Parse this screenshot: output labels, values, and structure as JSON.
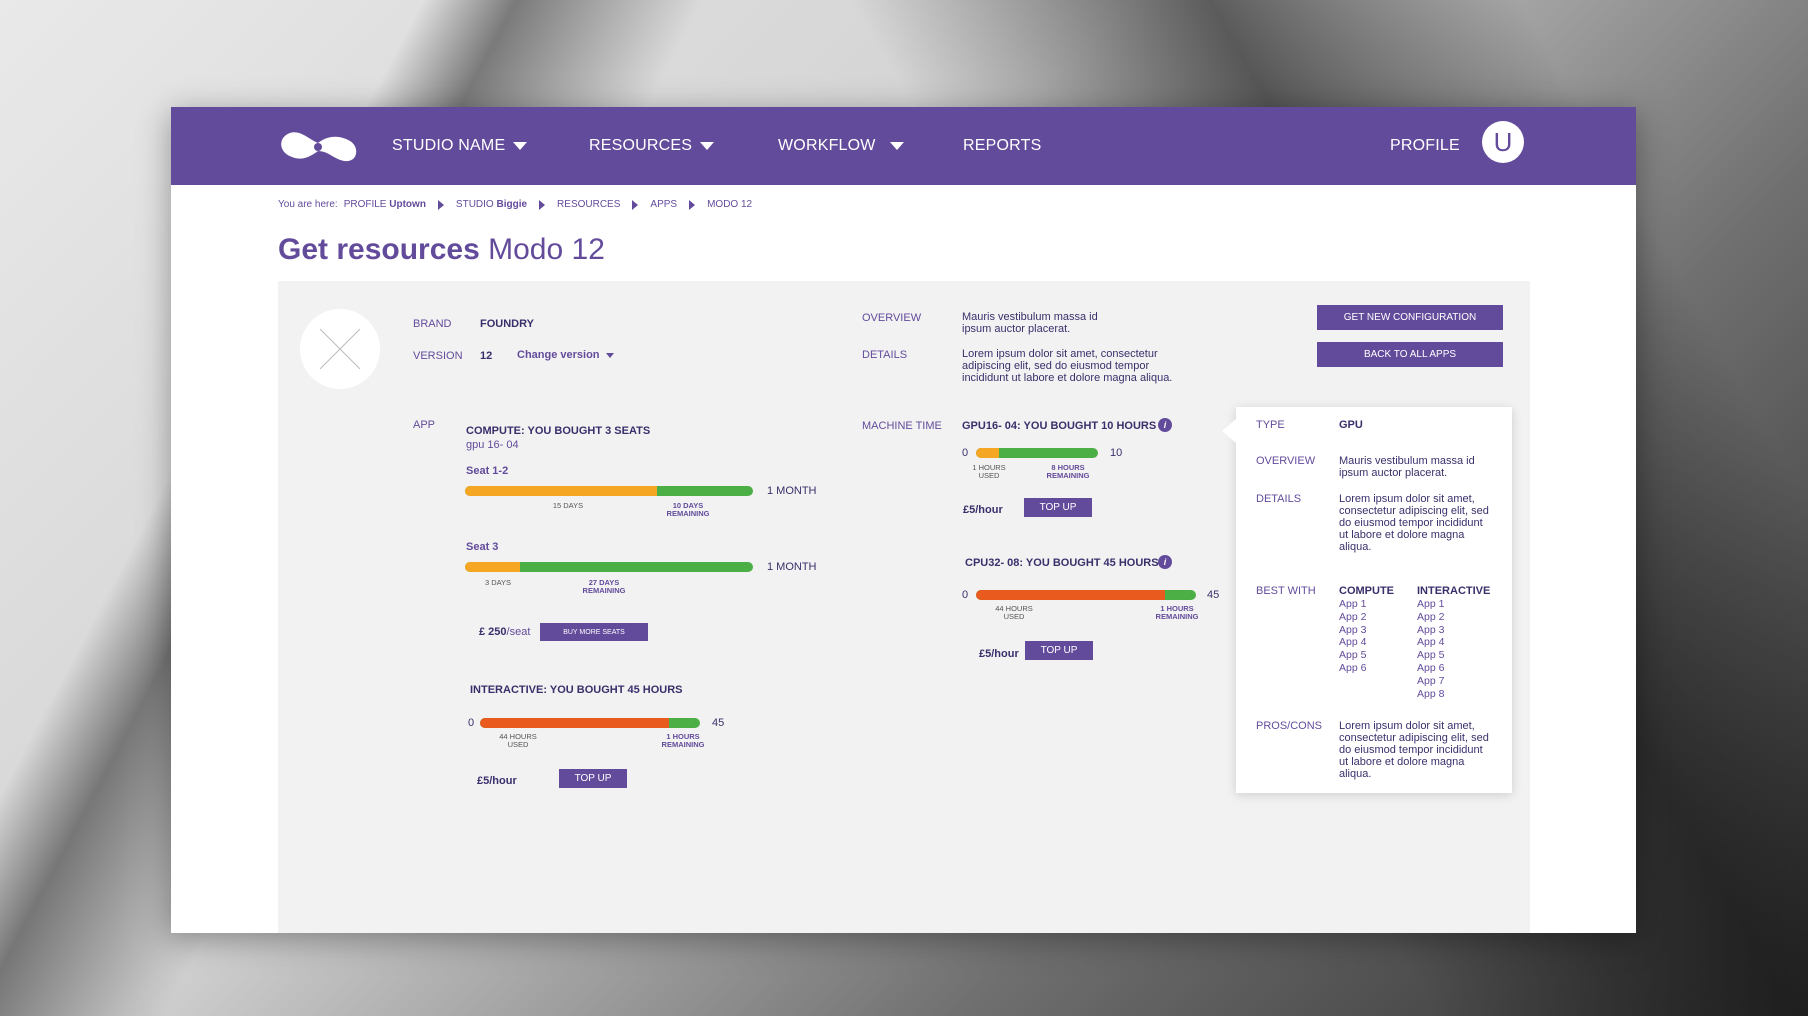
{
  "nav": {
    "studio": "STUDIO NAME",
    "resources": "RESOURCES",
    "workflow": "WORKFLOW",
    "reports": "REPORTS",
    "profile": "PROFILE",
    "avatar_initial": "U"
  },
  "breadcrumb": {
    "prefix": "You are here:",
    "profile_label": "PROFILE",
    "profile_value": "Uptown",
    "studio_label": "STUDIO",
    "studio_value": "Biggie",
    "resources": "RESOURCES",
    "apps": "APPS",
    "current": "MODO 12"
  },
  "title": {
    "bold": "Get resources",
    "rest": "Modo 12"
  },
  "product": {
    "brand_label": "BRAND",
    "brand_value": "FOUNDRY",
    "version_label": "VERSION",
    "version_value": "12",
    "change_version": "Change version",
    "overview_label": "OVERVIEW",
    "overview_text_1": "Mauris vestibulum massa id",
    "overview_text_2": "ipsum auctor placerat.",
    "details_label": "DETAILS",
    "details_text_1": "Lorem ipsum dolor sit amet, consectetur",
    "details_text_2": "adipiscing elit, sed do eiusmod tempor",
    "details_text_3": "incididunt ut labore et dolore magna aliqua.",
    "get_config": "GET NEW CONFIGURATION",
    "back_all": "BACK TO ALL APPS"
  },
  "app": {
    "label": "APP",
    "compute_title": "COMPUTE: YOU BOUGHT 3 SEATS",
    "compute_sub": "gpu 16- 04",
    "seat1": {
      "label": "Seat 1-2",
      "used_fraction": 0.665,
      "used": "15 DAYS",
      "remaining_1": "10 DAYS",
      "remaining_2": "REMAINING",
      "end": "1 MONTH"
    },
    "seat2": {
      "label": "Seat 3",
      "used_fraction": 0.19,
      "used": "3 DAYS",
      "remaining_1": "27 DAYS",
      "remaining_2": "REMAINING",
      "end": "1 MONTH"
    },
    "seat_price": "£ 250",
    "seat_unit": "/seat",
    "buy_more": "BUY MORE SEATS",
    "interactive_title": "INTERACTIVE: YOU BOUGHT 45 HOURS",
    "interactive": {
      "start": "0",
      "end": "45",
      "used_fraction": 0.86,
      "used_1": "44 HOURS",
      "used_2": "USED",
      "remaining_1": "1 HOURS",
      "remaining_2": "REMAINING"
    },
    "interactive_price": "£5/hour",
    "top_up": "TOP UP"
  },
  "machine": {
    "label": "MACHINE TIME",
    "gpu_title": "GPU16- 04: YOU BOUGHT 10 HOURS",
    "gpu": {
      "start": "0",
      "end": "10",
      "used_fraction": 0.19,
      "used_1": "1 HOURS",
      "used_2": "USED",
      "remaining_1": "8 HOURS",
      "remaining_2": "REMAINING"
    },
    "gpu_price": "£5/hour",
    "cpu_title": "CPU32- 08: YOU BOUGHT 45 HOURS",
    "cpu": {
      "start": "0",
      "end": "45",
      "used_fraction": 0.86,
      "used_1": "44 HOURS",
      "used_2": "USED",
      "remaining_1": "1 HOURS",
      "remaining_2": "REMAINING"
    },
    "cpu_price": "£5/hour",
    "top_up": "TOP UP",
    "info_glyph": "i"
  },
  "popover": {
    "type_label": "TYPE",
    "type_value": "GPU",
    "overview_label": "OVERVIEW",
    "overview_1": "Mauris vestibulum massa id",
    "overview_2": "ipsum auctor placerat.",
    "details_label": "DETAILS",
    "details_1": "Lorem ipsum dolor sit amet,",
    "details_2": "consectetur adipiscing elit, sed",
    "details_3": "do eiusmod tempor incididunt",
    "details_4": "ut labore et dolore magna",
    "details_5": "aliqua.",
    "best_label": "BEST WITH",
    "compute_head": "COMPUTE",
    "compute_apps": [
      "App 1",
      "App 2",
      "App 3",
      "App 4",
      "App 5",
      "App 6"
    ],
    "interactive_head": "INTERACTIVE",
    "interactive_apps": [
      "App 1",
      "App 2",
      "App 3",
      "App 4",
      "App 5",
      "App 6",
      "App 7",
      "App 8"
    ],
    "pros_label": "PROS/CONS",
    "pros_1": "Lorem ipsum dolor sit amet,",
    "pros_2": "consectetur adipiscing elit, sed",
    "pros_3": "do eiusmod tempor incididunt",
    "pros_4": "ut labore et dolore magna",
    "pros_5": "aliqua."
  },
  "colors": {
    "brand": "#634b9b",
    "green": "#4caf45",
    "orange": "#f5a623",
    "red": "#e85a1e"
  }
}
